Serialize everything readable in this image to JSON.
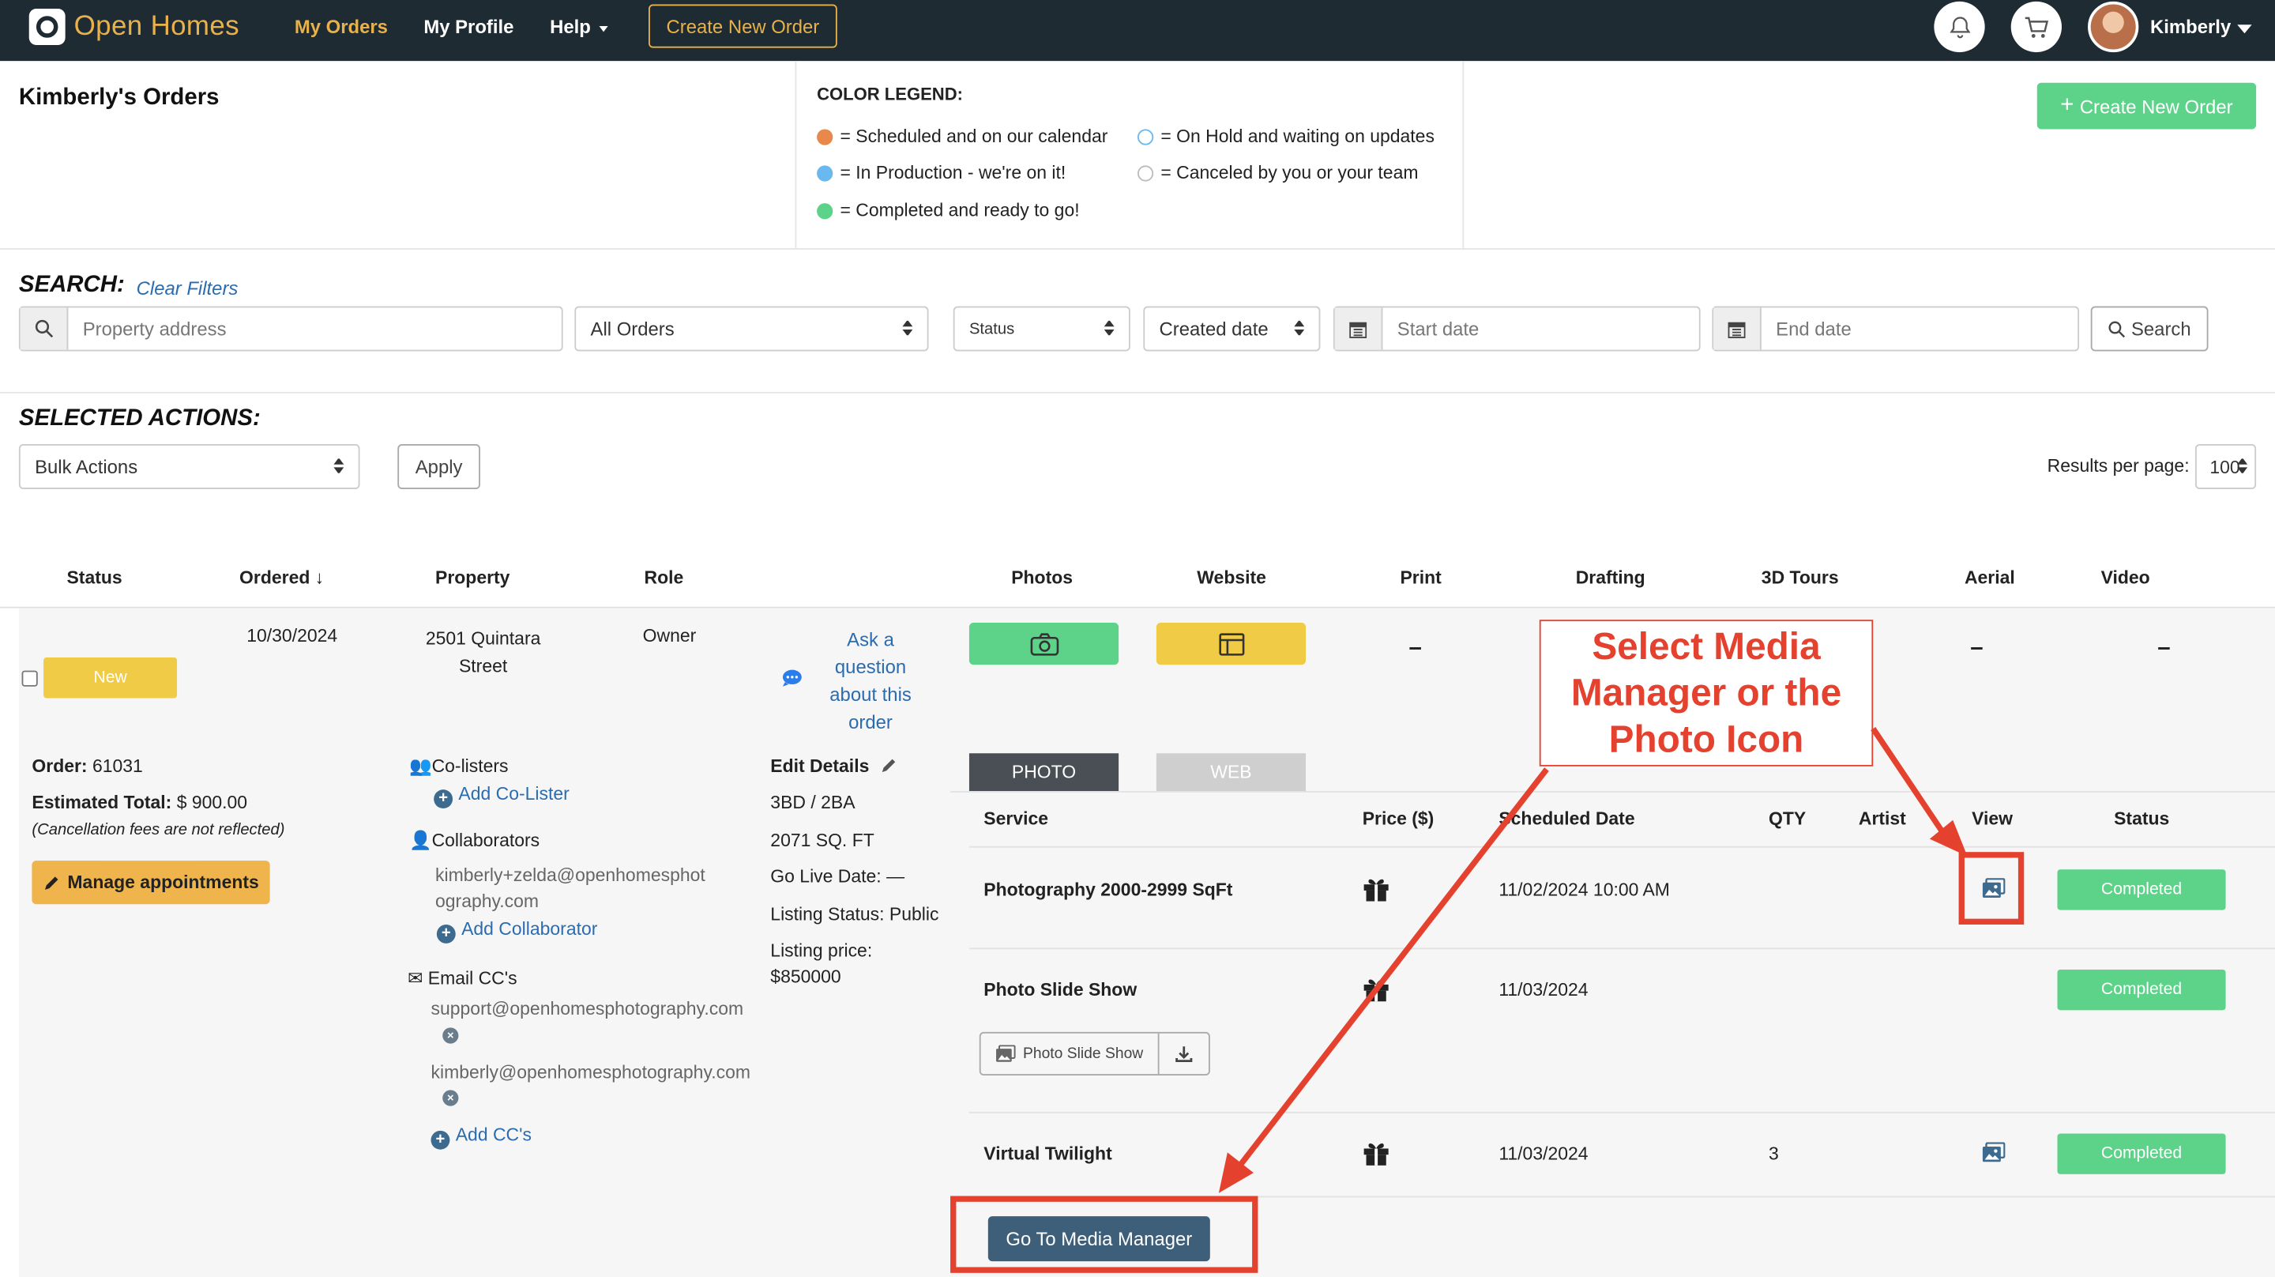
{
  "nav": {
    "brand": "Open Homes",
    "my_orders": "My Orders",
    "my_profile": "My Profile",
    "help": "Help",
    "create_new_order": "Create New Order",
    "user_name": "Kimberly"
  },
  "header": {
    "title": "Kimberly's Orders",
    "create_new_order": "Create New Order"
  },
  "legend": {
    "title": "COLOR LEGEND:",
    "items": [
      {
        "label": "= Scheduled and on our calendar",
        "color": "#e8884a"
      },
      {
        "label": "= In Production - we're on it!",
        "color": "#6ab8ee"
      },
      {
        "label": "= Completed and ready to go!",
        "color": "#5dd38a"
      },
      {
        "label": "= On Hold and waiting on updates",
        "color": "#6ab8ee"
      },
      {
        "label": "= Canceled by you or your team",
        "color": "#bbbbbb"
      }
    ]
  },
  "search": {
    "label": "SEARCH:",
    "clear_filters": "Clear Filters",
    "address_placeholder": "Property address",
    "order_filter": "All Orders",
    "status": "Status",
    "created_date": "Created date",
    "start_placeholder": "Start date",
    "end_placeholder": "End date",
    "search_button": "Search"
  },
  "actions": {
    "label": "SELECTED ACTIONS:",
    "bulk": "Bulk Actions",
    "apply": "Apply",
    "results_label": "Results per page:",
    "results_value": "100"
  },
  "table": {
    "headers": [
      "Status",
      "Ordered",
      "Property",
      "Role",
      "Photos",
      "Website",
      "Print",
      "Drafting",
      "3D Tours",
      "Aerial",
      "Video"
    ]
  },
  "order": {
    "status_badge": "New",
    "date": "10/30/2024",
    "property_line1": "2501 Quintara",
    "property_line2": "Street",
    "role": "Owner",
    "question_lines": [
      "Ask a",
      "question",
      "about this",
      "order"
    ],
    "dash": "–",
    "order_label": "Order:",
    "order_number": "61031",
    "total_label": "Estimated Total:",
    "total_value": "$ 900.00",
    "cancel_note": "(Cancellation fees are not reflected)",
    "manage_appointments": "Manage appointments",
    "colisters_label": "Co-listers",
    "add_colister": "Add Co-Lister",
    "collaborators_label": "Collaborators",
    "collaborator_email_1": "kimberly+zelda@openhomesphot",
    "collaborator_email_2": "ography.com",
    "add_collaborator": "Add Collaborator",
    "email_cc_label": "Email CC's",
    "cc_1": "support@openhomesphotography.com",
    "cc_2": "kimberly@openhomesphotography.com",
    "add_cc": "Add CC's",
    "edit_details": "Edit Details",
    "beds_baths": "3BD / 2BA",
    "sqft": "2071 SQ. FT",
    "go_live": "Go Live Date: —",
    "listing_status": "Listing Status: Public",
    "listing_price_label": "Listing price:",
    "listing_price": "$850000"
  },
  "services": {
    "tab_photo": "PHOTO",
    "tab_web": "WEB",
    "headers": {
      "service": "Service",
      "price": "Price ($)",
      "scheduled": "Scheduled Date",
      "qty": "QTY",
      "artist": "Artist",
      "view": "View",
      "status": "Status"
    },
    "rows": [
      {
        "name": "Photography 2000-2999 SqFt",
        "date": "11/02/2024 10:00 AM",
        "qty": "",
        "status": "Completed"
      },
      {
        "name": "Photo Slide Show",
        "date": "11/03/2024",
        "qty": "",
        "status": "Completed"
      },
      {
        "name": "Virtual Twilight",
        "date": "11/03/2024",
        "qty": "3",
        "status": "Completed"
      }
    ],
    "slide_show_button": "Photo Slide Show",
    "goto_media_manager": "Go To Media Manager"
  },
  "annotation": {
    "lines": [
      "Select Media",
      "Manager or the",
      "Photo Icon"
    ],
    "color": "#e5412f"
  }
}
